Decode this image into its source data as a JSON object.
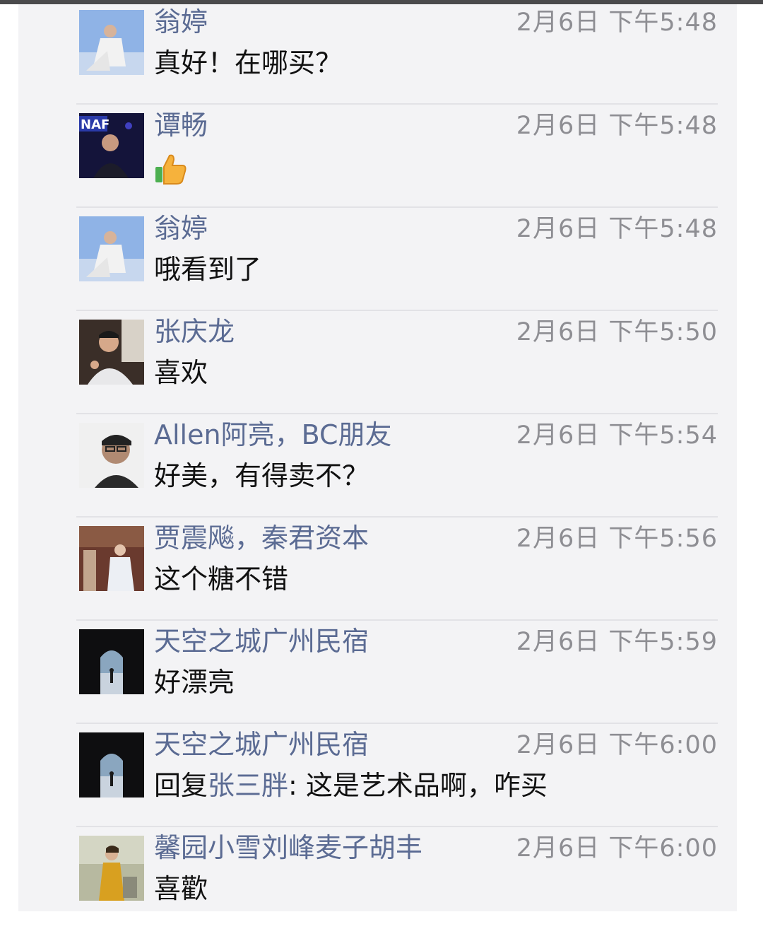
{
  "comments": [
    {
      "name": "翁婷",
      "time": "2月6日 下午5:48",
      "text": "真好！在哪买？"
    },
    {
      "name": "谭畅",
      "time": "2月6日 下午5:48",
      "emoji": "thumbs-up-icon"
    },
    {
      "name": "翁婷",
      "time": "2月6日 下午5:48",
      "text": "哦看到了"
    },
    {
      "name": "张庆龙",
      "time": "2月6日 下午5:50",
      "text": "喜欢"
    },
    {
      "name": "Allen阿亮，BC朋友",
      "time": "2月6日 下午5:54",
      "text": "好美，有得卖不？"
    },
    {
      "name": "贾震飚，秦君资本",
      "time": "2月6日 下午5:56",
      "text": "这个糖不错"
    },
    {
      "name": "天空之城广州民宿",
      "time": "2月6日 下午5:59",
      "text": "好漂亮"
    },
    {
      "name": "天空之城广州民宿",
      "time": "2月6日 下午6:00",
      "reply_prefix": "回复",
      "reply_to": "张三胖",
      "text": ": 这是艺术品啊，咋买"
    },
    {
      "name": "馨园小雪刘峰麦子胡丰",
      "time": "2月6日 下午6:00",
      "text": "喜歡"
    }
  ],
  "colors": {
    "name": "#5b6b93",
    "time": "#8e8e93",
    "text": "#111111",
    "background": "#f3f3f5",
    "divider": "#e2e2e6"
  }
}
